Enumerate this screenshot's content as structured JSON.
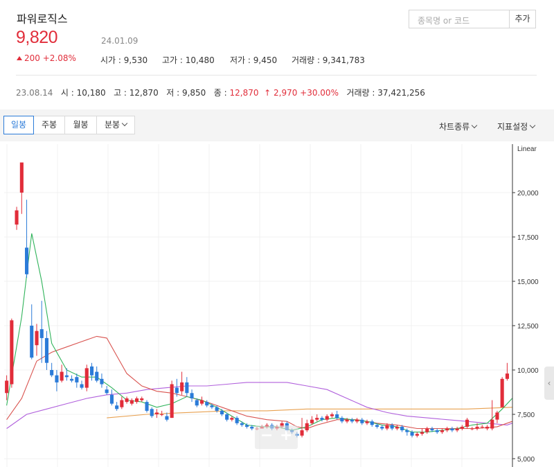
{
  "stock": {
    "name": "파워로직스",
    "price": "9,820",
    "date": "24.01.09",
    "change": "200 +2.08%"
  },
  "stats": [
    {
      "label": "시가",
      "value": "9,530"
    },
    {
      "label": "고가",
      "value": "10,480"
    },
    {
      "label": "저가",
      "value": "9,450"
    },
    {
      "label": "거래량",
      "value": "9,341,783"
    }
  ],
  "search": {
    "placeholder": "종목명 or 코드",
    "add_label": "추가"
  },
  "reference": {
    "date": "23.08.14",
    "open_label": "시",
    "open": "10,180",
    "high_label": "고",
    "high": "12,870",
    "low_label": "저",
    "low": "9,850",
    "close_label": "종",
    "close": "12,870",
    "change": "↑ 2,970 +30.00%",
    "volume_label": "거래량",
    "volume": "37,421,256"
  },
  "toolbar": {
    "tabs": [
      "일봉",
      "주봉",
      "월봉",
      "분봉"
    ],
    "active_tab": "일봉",
    "chart_type": "차트종류",
    "indicators": "지표설정"
  },
  "colors": {
    "up": "#e12d3a",
    "down": "#2b7bd8",
    "ma5": "#2fb35a",
    "ma20": "#d9534f",
    "ma60": "#b05fdc",
    "ma120": "#e8a04f"
  },
  "chart_data": {
    "type": "candlestick",
    "scale_label": "Linear",
    "y_ticks": [
      "20,000",
      "17,500",
      "15,000",
      "12,500",
      "10,000",
      "7,500",
      "5,000"
    ],
    "ylim": [
      5000,
      22000
    ],
    "candles": [
      [
        8700,
        9400,
        8300,
        9700
      ],
      [
        9200,
        12800,
        9000,
        12900
      ],
      [
        18200,
        19000,
        17900,
        19200
      ],
      [
        20000,
        21700,
        18800,
        21700
      ],
      [
        16900,
        15400,
        15200,
        19600
      ],
      [
        12500,
        10700,
        10600,
        13700
      ],
      [
        11400,
        12200,
        10800,
        12600
      ],
      [
        12300,
        11800,
        10400,
        13900
      ],
      [
        11800,
        10400,
        10000,
        12200
      ],
      [
        10000,
        9700,
        9600,
        10400
      ],
      [
        9700,
        9300,
        8800,
        10000
      ],
      [
        9400,
        9900,
        9300,
        10300
      ],
      [
        9700,
        9600,
        9400,
        10100
      ],
      [
        9500,
        9400,
        9300,
        9700
      ],
      [
        9600,
        9300,
        9000,
        9800
      ],
      [
        9200,
        9000,
        8900,
        9400
      ],
      [
        9000,
        10100,
        8800,
        10300
      ],
      [
        10200,
        9700,
        9400,
        10400
      ],
      [
        9900,
        9400,
        9300,
        10200
      ],
      [
        9500,
        9200,
        9000,
        9800
      ],
      [
        8900,
        8700,
        8600,
        9100
      ],
      [
        8600,
        8100,
        8000,
        8900
      ],
      [
        8000,
        7800,
        7700,
        8200
      ],
      [
        7900,
        8300,
        7800,
        8500
      ],
      [
        8200,
        8400,
        8100,
        8500
      ],
      [
        8100,
        8300,
        8000,
        8400
      ],
      [
        8200,
        8400,
        8100,
        8500
      ],
      [
        8300,
        8400,
        8200,
        8500
      ],
      [
        8200,
        7700,
        7600,
        8300
      ],
      [
        7800,
        7400,
        7300,
        7900
      ],
      [
        7500,
        7600,
        7300,
        7800
      ],
      [
        7500,
        7500,
        7400,
        7700
      ],
      [
        7400,
        7200,
        7100,
        7600
      ],
      [
        7300,
        9200,
        7300,
        9400
      ],
      [
        9000,
        8700,
        8500,
        9500
      ],
      [
        8800,
        9300,
        8600,
        9900
      ],
      [
        9300,
        8700,
        8500,
        9600
      ],
      [
        8700,
        8400,
        8200,
        8900
      ],
      [
        8300,
        8000,
        7900,
        8400
      ],
      [
        8100,
        8300,
        8000,
        8500
      ],
      [
        8200,
        8000,
        7900,
        8300
      ],
      [
        8000,
        7900,
        7800,
        8100
      ],
      [
        7900,
        7700,
        7600,
        8000
      ],
      [
        7700,
        7500,
        7400,
        7800
      ],
      [
        7500,
        7200,
        7100,
        7600
      ],
      [
        7200,
        7300,
        7100,
        7400
      ],
      [
        7300,
        7000,
        6900,
        7400
      ],
      [
        7000,
        6900,
        6800,
        7100
      ],
      [
        6900,
        6800,
        6700,
        7000
      ],
      [
        6800,
        6700,
        6600,
        6900
      ],
      [
        6700,
        6700,
        6600,
        6800
      ],
      [
        6700,
        6800,
        6700,
        6900
      ],
      [
        6800,
        6900,
        6700,
        7000
      ],
      [
        6900,
        6700,
        6600,
        7000
      ],
      [
        6700,
        6800,
        6600,
        6900
      ],
      [
        6800,
        7000,
        6700,
        7100
      ],
      [
        7000,
        6600,
        6500,
        7100
      ],
      [
        6600,
        6500,
        6400,
        6700
      ],
      [
        6400,
        6300,
        6200,
        6500
      ],
      [
        6300,
        6600,
        6200,
        7300
      ],
      [
        6600,
        7000,
        6500,
        7200
      ],
      [
        7000,
        7200,
        6900,
        7400
      ],
      [
        7200,
        7300,
        7100,
        7500
      ],
      [
        7300,
        7200,
        7100,
        7400
      ],
      [
        7200,
        7400,
        7100,
        7500
      ],
      [
        7400,
        7500,
        7300,
        7600
      ],
      [
        7500,
        7300,
        7200,
        7700
      ],
      [
        7300,
        7100,
        7000,
        7400
      ],
      [
        7100,
        7200,
        7000,
        7300
      ],
      [
        7200,
        7100,
        7000,
        7300
      ],
      [
        7100,
        7200,
        7000,
        7300
      ],
      [
        7200,
        7000,
        6900,
        7300
      ],
      [
        7000,
        7100,
        6900,
        7200
      ],
      [
        7100,
        6900,
        6800,
        7200
      ],
      [
        6900,
        6800,
        6700,
        7000
      ],
      [
        6800,
        6700,
        6600,
        6900
      ],
      [
        6700,
        6900,
        6600,
        7000
      ],
      [
        6900,
        6700,
        6600,
        7000
      ],
      [
        6700,
        6800,
        6600,
        6900
      ],
      [
        6800,
        6600,
        6500,
        6900
      ],
      [
        6600,
        6500,
        6300,
        6700
      ],
      [
        6500,
        6300,
        6200,
        6600
      ],
      [
        6300,
        6400,
        6200,
        6500
      ],
      [
        6400,
        6500,
        6300,
        6700
      ],
      [
        6500,
        6700,
        6400,
        6800
      ],
      [
        6700,
        6600,
        6500,
        6800
      ],
      [
        6600,
        6500,
        6400,
        6700
      ],
      [
        6500,
        6600,
        6400,
        6700
      ],
      [
        6600,
        6700,
        6500,
        6800
      ],
      [
        6700,
        6600,
        6500,
        6800
      ],
      [
        6600,
        6700,
        6500,
        6800
      ],
      [
        6700,
        6800,
        6600,
        6900
      ],
      [
        6800,
        7200,
        6700,
        7300
      ],
      [
        6700,
        6700,
        6600,
        6800
      ],
      [
        6700,
        6800,
        6600,
        7000
      ],
      [
        6800,
        6800,
        6700,
        6900
      ],
      [
        6700,
        6800,
        6600,
        6900
      ],
      [
        6700,
        7200,
        6600,
        8300
      ],
      [
        7200,
        7600,
        7000,
        7700
      ],
      [
        7900,
        9500,
        7900,
        9600
      ],
      [
        9500,
        9800,
        9400,
        10400
      ]
    ],
    "ma5": [
      [
        0,
        8000
      ],
      [
        3,
        13000
      ],
      [
        5,
        17700
      ],
      [
        7,
        15000
      ],
      [
        9,
        11500
      ],
      [
        12,
        10000
      ],
      [
        15,
        9600
      ],
      [
        18,
        9600
      ],
      [
        21,
        9000
      ],
      [
        24,
        8300
      ],
      [
        27,
        8200
      ],
      [
        30,
        7900
      ],
      [
        33,
        8100
      ],
      [
        36,
        8500
      ],
      [
        39,
        8300
      ],
      [
        42,
        7900
      ],
      [
        45,
        7400
      ],
      [
        48,
        6900
      ],
      [
        51,
        6800
      ],
      [
        54,
        6800
      ],
      [
        57,
        6600
      ],
      [
        60,
        6800
      ],
      [
        63,
        7200
      ],
      [
        66,
        7300
      ],
      [
        69,
        7200
      ],
      [
        72,
        7100
      ],
      [
        75,
        6900
      ],
      [
        78,
        6800
      ],
      [
        81,
        6500
      ],
      [
        84,
        6500
      ],
      [
        87,
        6600
      ],
      [
        90,
        6700
      ],
      [
        93,
        6900
      ],
      [
        96,
        7000
      ],
      [
        99,
        7800
      ],
      [
        101,
        8400
      ]
    ],
    "ma20": [
      [
        0,
        7200
      ],
      [
        3,
        8400
      ],
      [
        6,
        10500
      ],
      [
        9,
        11000
      ],
      [
        12,
        11300
      ],
      [
        15,
        11600
      ],
      [
        18,
        11900
      ],
      [
        20,
        11800
      ],
      [
        22,
        10800
      ],
      [
        24,
        9800
      ],
      [
        27,
        9100
      ],
      [
        30,
        8800
      ],
      [
        33,
        8700
      ],
      [
        36,
        8500
      ],
      [
        40,
        8200
      ],
      [
        44,
        7800
      ],
      [
        48,
        7400
      ],
      [
        52,
        7200
      ],
      [
        56,
        7100
      ],
      [
        58,
        6800
      ],
      [
        60,
        6700
      ],
      [
        62,
        6900
      ],
      [
        66,
        7200
      ],
      [
        70,
        7200
      ],
      [
        74,
        7000
      ],
      [
        78,
        6900
      ],
      [
        82,
        6700
      ],
      [
        86,
        6700
      ],
      [
        90,
        6700
      ],
      [
        94,
        6700
      ],
      [
        98,
        6800
      ],
      [
        101,
        7100
      ]
    ],
    "ma60": [
      [
        0,
        6700
      ],
      [
        4,
        7500
      ],
      [
        8,
        7800
      ],
      [
        12,
        8100
      ],
      [
        16,
        8400
      ],
      [
        20,
        8600
      ],
      [
        24,
        8700
      ],
      [
        28,
        8900
      ],
      [
        32,
        9000
      ],
      [
        36,
        9100
      ],
      [
        40,
        9100
      ],
      [
        44,
        9200
      ],
      [
        48,
        9300
      ],
      [
        52,
        9300
      ],
      [
        56,
        9300
      ],
      [
        60,
        9100
      ],
      [
        64,
        8900
      ],
      [
        68,
        8400
      ],
      [
        72,
        7900
      ],
      [
        76,
        7600
      ],
      [
        80,
        7400
      ],
      [
        84,
        7300
      ],
      [
        88,
        7200
      ],
      [
        92,
        7100
      ],
      [
        96,
        7000
      ],
      [
        100,
        6900
      ],
      [
        101,
        7000
      ]
    ],
    "ma120": [
      [
        20,
        7300
      ],
      [
        28,
        7500
      ],
      [
        36,
        7600
      ],
      [
        44,
        7700
      ],
      [
        52,
        7700
      ],
      [
        60,
        7800
      ],
      [
        68,
        7800
      ],
      [
        76,
        7800
      ],
      [
        84,
        7800
      ],
      [
        92,
        7800
      ],
      [
        101,
        7900
      ]
    ]
  }
}
